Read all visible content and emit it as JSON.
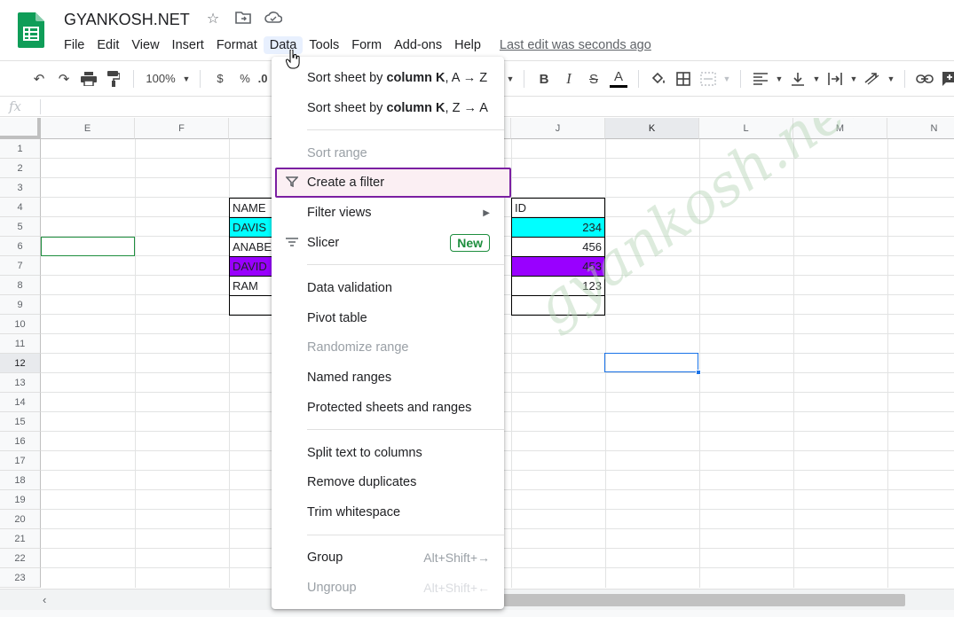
{
  "doc": {
    "title": "GYANKOSH.NET",
    "last_edit": "Last edit was seconds ago"
  },
  "menubar": [
    "File",
    "Edit",
    "View",
    "Insert",
    "Format",
    "Data",
    "Tools",
    "Form",
    "Add-ons",
    "Help"
  ],
  "toolbar": {
    "zoom": "100%",
    "currency": "$",
    "percent": "%",
    "decimal": ".0"
  },
  "formula_bar": {
    "fx": "fx"
  },
  "columns": [
    "E",
    "F",
    "",
    "",
    "",
    "J",
    "K",
    "L",
    "M",
    "N"
  ],
  "rows": [
    "1",
    "2",
    "3",
    "4",
    "5",
    "6",
    "7",
    "8",
    "9",
    "10",
    "11",
    "12",
    "13",
    "14",
    "15",
    "16",
    "17",
    "18",
    "19",
    "20",
    "21",
    "22",
    "23"
  ],
  "table": {
    "name_header": "NAME",
    "id_header": "ID",
    "names": [
      "DAVIS",
      "ANABE",
      "DAVID",
      "RAM"
    ],
    "ids": [
      "234",
      "456",
      "453",
      "123"
    ],
    "row_colors": [
      "#00ffff",
      "#ffffff",
      "#9900ff",
      "#ffffff"
    ]
  },
  "watermark": "gyankosh.net",
  "data_menu": {
    "sort_az_prefix": "Sort sheet by ",
    "sort_az_bold": "column K",
    "sort_az_suffix": ", A → Z",
    "sort_za_prefix": "Sort sheet by ",
    "sort_za_bold": "column K",
    "sort_za_suffix": ", Z → A",
    "sort_range": "Sort range",
    "create_filter": "Create a filter",
    "filter_views": "Filter views",
    "slicer": "Slicer",
    "slicer_badge": "New",
    "data_validation": "Data validation",
    "pivot_table": "Pivot table",
    "randomize_range": "Randomize range",
    "named_ranges": "Named ranges",
    "protected": "Protected sheets and ranges",
    "split_text": "Split text to columns",
    "remove_duplicates": "Remove duplicates",
    "trim_whitespace": "Trim whitespace",
    "group": "Group",
    "group_shortcut": "Alt+Shift+→",
    "ungroup": "Ungroup",
    "ungroup_shortcut": "Alt+Shift+←"
  },
  "colors": {
    "highlight_border": "#7b1fa2",
    "new_badge": "#1e8e3e",
    "selection": "#1a73e8"
  }
}
